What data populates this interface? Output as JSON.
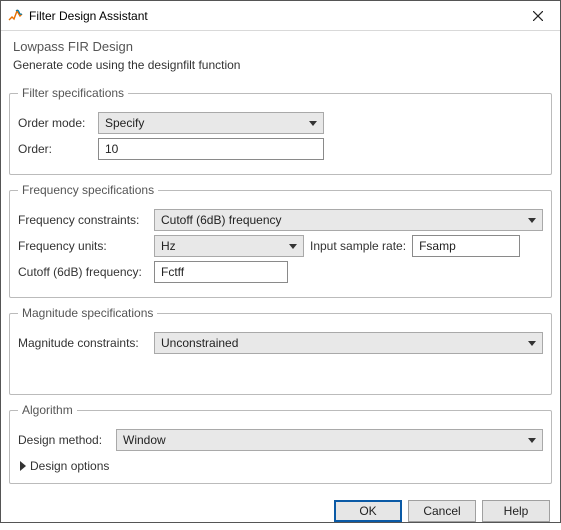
{
  "window": {
    "title": "Filter Design Assistant"
  },
  "header": {
    "title": "Lowpass FIR Design",
    "subtitle": "Generate code using the designfilt function"
  },
  "filterSpec": {
    "legend": "Filter specifications",
    "orderModeLabel": "Order mode:",
    "orderModeValue": "Specify",
    "orderLabel": "Order:",
    "orderValue": "10"
  },
  "freqSpec": {
    "legend": "Frequency specifications",
    "constraintsLabel": "Frequency constraints:",
    "constraintsValue": "Cutoff (6dB) frequency",
    "unitsLabel": "Frequency units:",
    "unitsValue": "Hz",
    "sampleRateLabel": "Input sample rate:",
    "sampleRateValue": "Fsamp",
    "cutoffLabel": "Cutoff (6dB) frequency:",
    "cutoffValue": "Fctff"
  },
  "magSpec": {
    "legend": "Magnitude specifications",
    "constraintsLabel": "Magnitude constraints:",
    "constraintsValue": "Unconstrained"
  },
  "algorithm": {
    "legend": "Algorithm",
    "methodLabel": "Design method:",
    "methodValue": "Window",
    "optionsLabel": "Design options"
  },
  "footer": {
    "ok": "OK",
    "cancel": "Cancel",
    "help": "Help"
  }
}
